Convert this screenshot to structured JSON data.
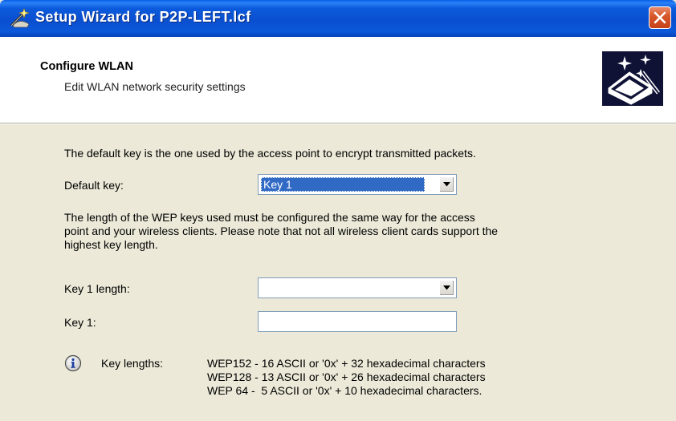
{
  "window": {
    "title": "Setup Wizard for P2P-LEFT.lcf"
  },
  "header": {
    "title": "Configure WLAN",
    "subtitle": "Edit WLAN network security settings"
  },
  "content": {
    "default_key_intro": "The default key is the one used by the access point to encrypt transmitted packets.",
    "default_key_label": "Default key:",
    "default_key_value": "Key 1",
    "wep_length_note": [
      "The length of the WEP keys used must be configured the same way for the access",
      "point and your wireless clients. Please note that not all wireless client cards support the",
      "highest key length."
    ],
    "key1_length_label": "Key 1 length:",
    "key1_length_value": "",
    "key1_label": "Key 1:",
    "key1_value": "",
    "key_lengths_label": "Key lengths:",
    "key_lengths": [
      "WEP152 - 16 ASCII or '0x' + 32 hexadecimal characters",
      "WEP128 - 13 ASCII or '0x' + 26 hexadecimal characters",
      "WEP 64 -  5 ASCII or '0x' + 10 hexadecimal characters."
    ]
  },
  "colors": {
    "titlebar": "#0A4FD0",
    "dialog_bg": "#ECE9D8",
    "selection": "#316AC5",
    "close_button": "#D8582C"
  },
  "icons": [
    "wizard-icon",
    "close-icon",
    "wizard-header-icon",
    "info-icon",
    "dropdown-arrow-icon"
  ]
}
